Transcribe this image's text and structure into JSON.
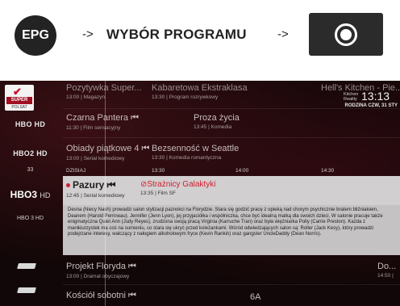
{
  "header": {
    "epg_label": "EPG",
    "arrow1": "->",
    "step_title": "WYBÓR PROGRAMU",
    "arrow2": "->",
    "ok_button_icon": "ok-circle-icon"
  },
  "channels": {
    "super_polsat": {
      "name": "SUPER",
      "sub": "POLSAT"
    },
    "hbo": "HBO HD",
    "hbo2": "HBO2 HD",
    "ch33": "33",
    "hbo3": {
      "main": "HBO3",
      "suffix": "HD"
    },
    "hbo3_hd_label": "HBO 3 HD"
  },
  "clock": {
    "small_line1": "Kitchen",
    "small_line2": "Reality",
    "time": "13:13",
    "date_line": "RODZINA   CZW, 31 STY"
  },
  "rows": [
    {
      "title": "Pozytywka Super...",
      "sub": "13:00 | Magazyn",
      "title2": "Kabaretowa Ekstraklasa",
      "sub2": "13:30 | Program rozrywkowy",
      "title3": "Hell's Kitchen - Pie...",
      "sub3": ""
    },
    {
      "title": "Czarna Pantera ⏮",
      "sub": "11:30 | Film sensacyjny",
      "title2": "Proza życia",
      "sub2": "13:45 | Komedia"
    },
    {
      "title": "Obiady piątkowe 4 ⏮",
      "sub": "13:00 | Serial komediowy",
      "title2": "Bezsenność w Seattle",
      "sub2": "13:30 | Komedia romantyczna"
    }
  ],
  "timeline": {
    "label": "DZISIAJ",
    "t1": "13:30",
    "t2": "14:00",
    "t3": "14:30"
  },
  "selected": {
    "title": "Pazury ⏮",
    "sub": "12:45 | Serial komediowy",
    "title2": "Strażnicy Galaktyki",
    "sub2": "13:35 | Film SF"
  },
  "description": "Desna (Niecy Nash) prowadzi salon stylizacji paznokci na Florydzie. Stara się godzić pracę z opieką nad chorym psychicznie bratem bliźniakiem, Deanem (Harold Perrineau). Jennifer (Jenn Lyon), jej przyjaciółka i współniczka, chce być idealną matką dla swoich dzieci. W salonie pracuje także enigmatyczna Quiet Ann (Judy Reyes), zrudzona swoją pracą Virginia (Karruche Tran) oraz była więźniarka Polly (Carrie Preston). Każda z manikiurzystek ma coś na sumieniu, co stara się ukryć przed koleżankami. Wśród odwiedzających salon są: Roller (Jack Kesy), który prowadzi podejrzane interesy, walczący z nałogiem alkoholowym fryce (Kevin Rankin) oraz gangster UncleDaddy (Dean Norris).",
  "lower_rows": [
    {
      "title": "Projekt Floryda ⏮",
      "sub": "13:00 | Dramat obyczajowy",
      "title_right": "Do...",
      "sub_right": "14:50 |"
    },
    {
      "title": "Kościół sobotni ⏮",
      "sub": "",
      "title2": "6A"
    }
  ]
}
